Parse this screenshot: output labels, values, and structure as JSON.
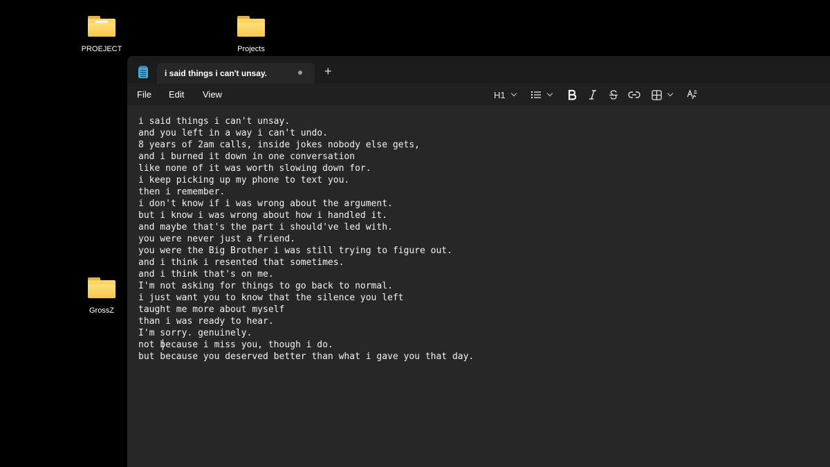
{
  "desktop": {
    "icons": [
      {
        "label": "PROEJECT"
      },
      {
        "label": "Projects"
      },
      {
        "label": "GrossZ"
      }
    ]
  },
  "window": {
    "tab_title": "i said things i can't unsay.",
    "new_tab_glyph": "+",
    "menu": {
      "file": "File",
      "edit": "Edit",
      "view": "View"
    },
    "toolbar": {
      "heading": "H1"
    },
    "lines": [
      "i said things i can't unsay.",
      "and you left in a way i can't undo.",
      "8 years of 2am calls, inside jokes nobody else gets,",
      "and i burned it down in one conversation",
      "like none of it was worth slowing down for.",
      "i keep picking up my phone to text you.",
      "then i remember.",
      "i don't know if i was wrong about the argument.",
      "but i know i was wrong about how i handled it.",
      "and maybe that's the part i should've led with.",
      "you were never just a friend.",
      "you were the Big Brother i was still trying to figure out.",
      "and i think i resented that sometimes.",
      "and i think that's on me.",
      "I'm not asking for things to go back to normal.",
      "i just want you to know that the silence you left",
      "taught me more about myself",
      "than i was ready to hear.",
      "I'm sorry. genuinely.",
      "not because i miss you, though i do.",
      "but because you deserved better than what i gave you that day."
    ]
  }
}
